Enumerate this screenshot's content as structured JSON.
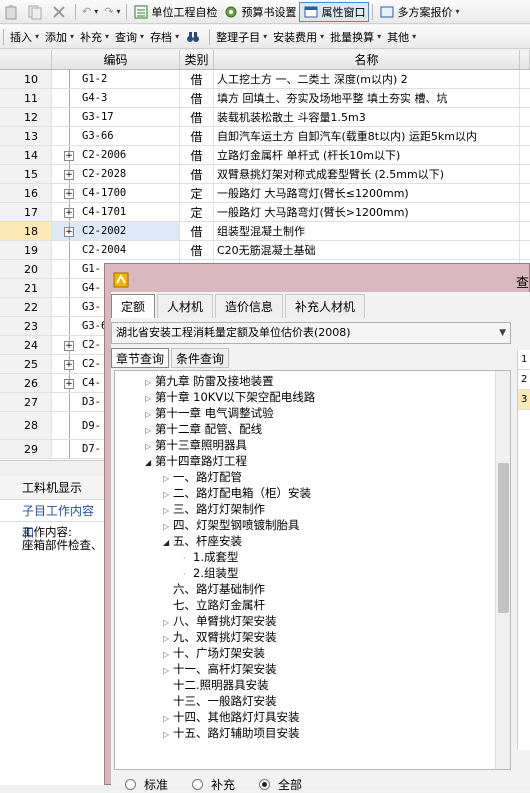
{
  "toolbar1": {
    "items": [
      "单位工程自检",
      "预算书设置",
      "属性窗口",
      "多方案报价"
    ],
    "active_index": 2
  },
  "toolbar2": {
    "menus": [
      "插入",
      "添加",
      "补充",
      "查询",
      "存档",
      "整理子目",
      "安装费用",
      "批量换算",
      "其他"
    ]
  },
  "grid": {
    "headers": {
      "code": "编码",
      "type": "类别",
      "name": "名称"
    },
    "rows": [
      {
        "no": "10",
        "code": "G1-2",
        "type": "借",
        "name": "人工挖土方 一、二类土 深度(m以内) 2",
        "expand": false
      },
      {
        "no": "11",
        "code": "G4-3",
        "type": "借",
        "name": "填方 回填土、夯实及场地平整 填土夯实 槽、坑",
        "expand": false
      },
      {
        "no": "12",
        "code": "G3-17",
        "type": "借",
        "name": "装载机装松散土 斗容量1.5m3",
        "expand": false
      },
      {
        "no": "13",
        "code": "G3-66",
        "type": "借",
        "name": "自卸汽车运土方 自卸汽车(载重8t以内) 运距5km以内",
        "expand": false
      },
      {
        "no": "14",
        "code": "C2-2006",
        "type": "借",
        "name": "立路灯金属杆 单杆式 (杆长10m以下)",
        "expand": true
      },
      {
        "no": "15",
        "code": "C2-2028",
        "type": "借",
        "name": "双臂悬挑灯架对称式成套型臂长 (2.5mm以下)",
        "expand": true
      },
      {
        "no": "16",
        "code": "C4-1700",
        "type": "定",
        "name": "一般路灯 大马路弯灯(臂长≤1200mm)",
        "expand": true
      },
      {
        "no": "17",
        "code": "C4-1701",
        "type": "定",
        "name": "一般路灯 大马路弯灯(臂长>1200mm)",
        "expand": true
      },
      {
        "no": "18",
        "code": "C2-2002",
        "type": "借",
        "name": "组装型混凝土制作",
        "expand": true
      },
      {
        "no": "19",
        "code": "C2-2004",
        "type": "借",
        "name": "C20无筋混凝土基础",
        "expand": false
      },
      {
        "no": "20",
        "code": "G1-",
        "type": "",
        "name": "",
        "expand": false
      },
      {
        "no": "21",
        "code": "G4-",
        "type": "",
        "name": "",
        "expand": false
      },
      {
        "no": "22",
        "code": "G3-",
        "type": "",
        "name": "",
        "expand": false
      },
      {
        "no": "23",
        "code": "G3-6",
        "type": "",
        "name": "",
        "expand": false
      },
      {
        "no": "24",
        "code": "C2-",
        "type": "",
        "name": "",
        "expand": true
      },
      {
        "no": "25",
        "code": "C2-",
        "type": "",
        "name": "",
        "expand": true
      },
      {
        "no": "26",
        "code": "C4-",
        "type": "",
        "name": "",
        "expand": true
      },
      {
        "no": "27",
        "code": "D3-",
        "type": "",
        "name": "",
        "expand": false
      },
      {
        "no": "28",
        "code": "D9-",
        "type": "",
        "name": "",
        "expand": false
      },
      {
        "no": "29",
        "code": "D7-",
        "type": "",
        "name": "",
        "expand": false
      }
    ],
    "selected_no": "18"
  },
  "left_pane": {
    "tab": "工料机显示",
    "title": "子目工作内容和",
    "body": [
      "工作内容:",
      "座箱部件检查、"
    ]
  },
  "dialog": {
    "title": "查",
    "tabs": [
      "定额",
      "人材机",
      "造价信息",
      "补充人材机"
    ],
    "active_tab": 0,
    "library": "湖北省安装工程消耗量定额及单位估价表(2008)",
    "subtabs": [
      "章节查询",
      "条件查询"
    ],
    "active_subtab": 0,
    "tree": [
      {
        "label": "第九章 防雷及接地装置",
        "level": 0,
        "state": "closed"
      },
      {
        "label": "第十章 10KV以下架空配电线路",
        "level": 0,
        "state": "closed"
      },
      {
        "label": "第十一章 电气调整试验",
        "level": 0,
        "state": "closed"
      },
      {
        "label": "第十二章 配管、配线",
        "level": 0,
        "state": "closed"
      },
      {
        "label": "第十三章照明器具",
        "level": 0,
        "state": "closed"
      },
      {
        "label": "第十四章路灯工程",
        "level": 0,
        "state": "open"
      },
      {
        "label": "一、路灯配管",
        "level": 1,
        "state": "closed"
      },
      {
        "label": "二、路灯配电箱（柜）安装",
        "level": 1,
        "state": "closed"
      },
      {
        "label": "三、路灯灯架制作",
        "level": 1,
        "state": "closed"
      },
      {
        "label": "四、灯架型钢喷镀制胎具",
        "level": 1,
        "state": "closed"
      },
      {
        "label": "五、杆座安装",
        "level": 1,
        "state": "open"
      },
      {
        "label": "1.成套型",
        "level": 2,
        "state": "leaf"
      },
      {
        "label": "2.组装型",
        "level": 2,
        "state": "leaf"
      },
      {
        "label": "六、路灯基础制作",
        "level": 1,
        "state": "none"
      },
      {
        "label": "七、立路灯金属杆",
        "level": 1,
        "state": "none"
      },
      {
        "label": "八、单臂挑灯架安装",
        "level": 1,
        "state": "closed"
      },
      {
        "label": "九、双臂挑灯架安装",
        "level": 1,
        "state": "closed"
      },
      {
        "label": "十、广场灯架安装",
        "level": 1,
        "state": "closed"
      },
      {
        "label": "十一、高杆灯架安装",
        "level": 1,
        "state": "closed"
      },
      {
        "label": "十二.照明器具安装",
        "level": 1,
        "state": "none"
      },
      {
        "label": "十三、一般路灯安装",
        "level": 1,
        "state": "none"
      },
      {
        "label": "十四、其他路灯灯具安装",
        "level": 1,
        "state": "closed"
      },
      {
        "label": "十五、路灯辅助项目安装",
        "level": 1,
        "state": "closed"
      }
    ],
    "radios": [
      "标准",
      "补充",
      "全部"
    ],
    "radio_selected": 2,
    "side_numbers": [
      "1",
      "2",
      "3"
    ]
  }
}
